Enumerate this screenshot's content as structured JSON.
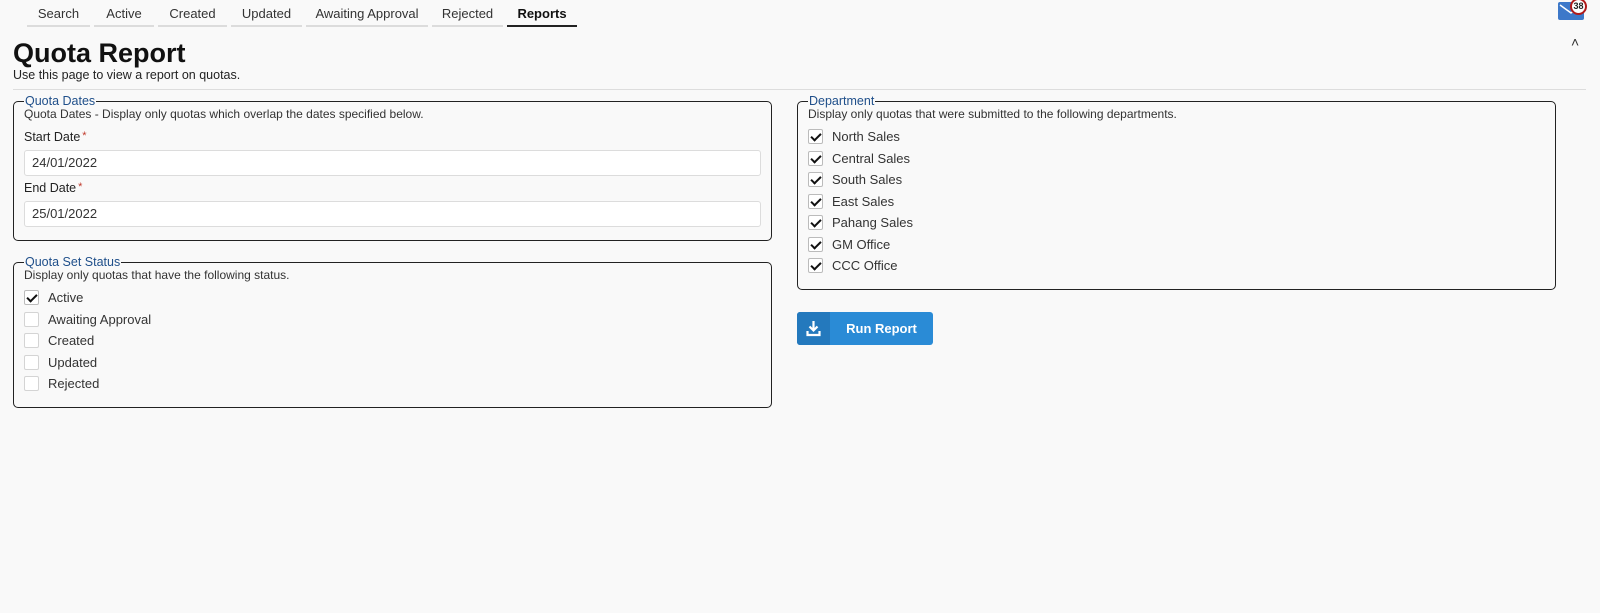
{
  "tabs": [
    {
      "label": "Search",
      "active": false
    },
    {
      "label": "Active",
      "active": false
    },
    {
      "label": "Created",
      "active": false
    },
    {
      "label": "Updated",
      "active": false
    },
    {
      "label": "Awaiting Approval",
      "active": false
    },
    {
      "label": "Rejected",
      "active": false
    },
    {
      "label": "Reports",
      "active": true
    }
  ],
  "header": {
    "mail_count": "38",
    "collapse_glyph": "˄",
    "title": "Quota Report",
    "subtitle": "Use this page to view a report on quotas."
  },
  "quota_dates": {
    "legend": "Quota Dates",
    "description": "Quota Dates - Display only quotas which overlap the dates specified below.",
    "start_label": "Start Date",
    "start_value": "24/01/2022",
    "end_label": "End Date",
    "end_value": "25/01/2022",
    "required_mark": "*"
  },
  "status": {
    "legend": "Quota Set Status",
    "description": "Display only quotas that have the following status.",
    "items": [
      {
        "label": "Active",
        "checked": true
      },
      {
        "label": "Awaiting Approval",
        "checked": false
      },
      {
        "label": "Created",
        "checked": false
      },
      {
        "label": "Updated",
        "checked": false
      },
      {
        "label": "Rejected",
        "checked": false
      }
    ]
  },
  "department": {
    "legend": "Department",
    "description": "Display only quotas that were submitted to the following departments.",
    "items": [
      {
        "label": "North Sales",
        "checked": true
      },
      {
        "label": "Central Sales",
        "checked": true
      },
      {
        "label": "South Sales",
        "checked": true
      },
      {
        "label": "East Sales",
        "checked": true
      },
      {
        "label": "Pahang Sales",
        "checked": true
      },
      {
        "label": "GM Office",
        "checked": true
      },
      {
        "label": "CCC Office",
        "checked": true
      }
    ]
  },
  "run_button": {
    "label": "Run Report",
    "icon": "download-icon"
  },
  "colors": {
    "accent": "#2a8bd6",
    "legend": "#1f4f8a",
    "badge_ring": "#b01a1a",
    "mail": "#3d78c9"
  }
}
